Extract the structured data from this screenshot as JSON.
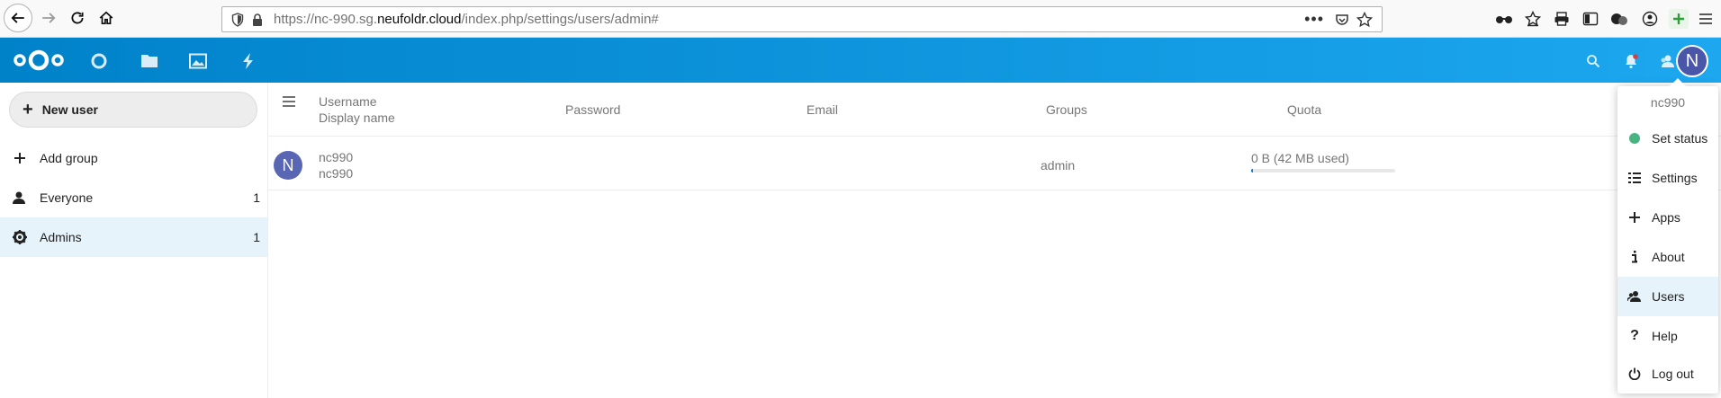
{
  "browser": {
    "url_prefix": "https://nc-990.sg.",
    "url_host": "neufoldr.cloud",
    "url_path": "/index.php/settings/users/admin#",
    "overflow_label": "•••"
  },
  "header": {
    "avatar_initial": "N"
  },
  "sidebar": {
    "new_user_label": "New user",
    "add_group_label": "Add group",
    "groups": [
      {
        "label": "Everyone",
        "count": "1",
        "icon": "users-icon"
      },
      {
        "label": "Admins",
        "count": "1",
        "icon": "admin-gear-icon"
      }
    ]
  },
  "user_list": {
    "columns": {
      "username": "Username",
      "display_name": "Display name",
      "password": "Password",
      "email": "Email",
      "groups": "Groups",
      "quota": "Quota"
    },
    "rows": [
      {
        "avatar_initial": "N",
        "username": "nc990",
        "display_name": "nc990",
        "groups": "admin",
        "quota_text": "0 B (42 MB used)",
        "quota_fill_fraction": 0.01
      }
    ]
  },
  "settings_menu": {
    "username": "nc990",
    "items": [
      {
        "label": "Set status",
        "icon": "status-dot-icon"
      },
      {
        "label": "Settings",
        "icon": "settings-list-icon"
      },
      {
        "label": "Apps",
        "icon": "plus-icon"
      },
      {
        "label": "About",
        "icon": "info-icon"
      },
      {
        "label": "Users",
        "icon": "users-icon"
      },
      {
        "label": "Help",
        "icon": "help-icon"
      },
      {
        "label": "Log out",
        "icon": "power-icon"
      }
    ]
  },
  "colors": {
    "brand": "#0082c9",
    "status_online": "#49b382",
    "avatar": "#4a56a8"
  }
}
